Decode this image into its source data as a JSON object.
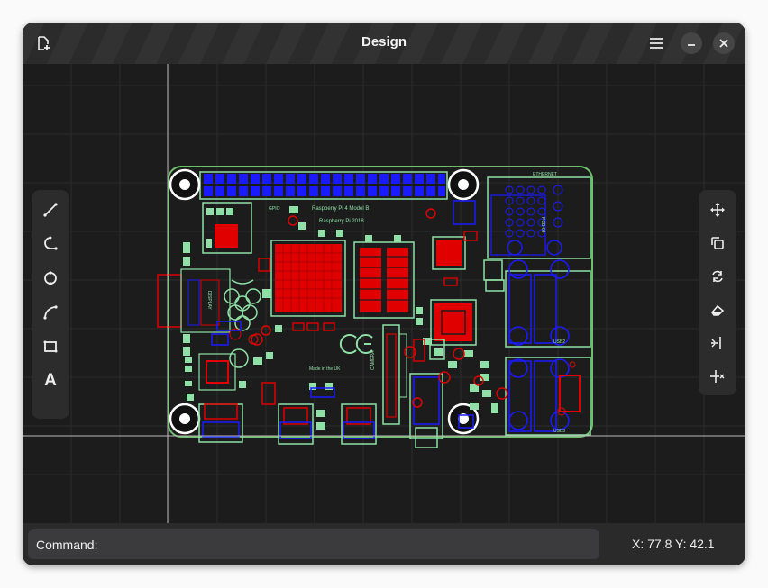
{
  "window": {
    "title": "Design"
  },
  "headerbar": {
    "new_icon": "new-document-icon",
    "menu_icon": "hamburger-menu-icon",
    "minimize_icon": "minimize-icon",
    "close_icon": "close-icon"
  },
  "left_toolbar": {
    "tools": [
      {
        "name": "line",
        "icon": "line-tool-icon"
      },
      {
        "name": "polyline",
        "icon": "polyline-tool-icon"
      },
      {
        "name": "circle",
        "icon": "circle-tool-icon"
      },
      {
        "name": "arc",
        "icon": "arc-tool-icon"
      },
      {
        "name": "rectangle",
        "icon": "rectangle-tool-icon"
      },
      {
        "name": "text",
        "icon": "text-tool-icon",
        "glyph": "A"
      }
    ]
  },
  "right_toolbar": {
    "tools": [
      {
        "name": "move",
        "icon": "move-icon"
      },
      {
        "name": "copy",
        "icon": "copy-icon"
      },
      {
        "name": "rotate",
        "icon": "rotate-icon"
      },
      {
        "name": "erase",
        "icon": "eraser-icon"
      },
      {
        "name": "trim",
        "icon": "trim-icon"
      },
      {
        "name": "extend",
        "icon": "extend-icon"
      }
    ]
  },
  "pcb": {
    "board_text": {
      "model": "Raspberry Pi 4 Model B",
      "year": "Raspberry Pi 2018",
      "made_in": "Made in the UK",
      "gpio": "GPIO",
      "display": "DISPLAY",
      "camera": "CAMERA",
      "ethernet": "ETHERNET",
      "usb2": "USB2",
      "usb3": "USB3",
      "pcb_rev": "PCB-84",
      "ce": "CE"
    },
    "colors": {
      "board_outline": "#6fbf6f",
      "silkscreen": "#8fe0a6",
      "top_copper": "#e00000",
      "bottom_copper": "#1a1aff",
      "grid": "#2c2c2c",
      "crosshair": "#b8b8b8",
      "pad_white": "#ffffff"
    }
  },
  "command": {
    "label": "Command:",
    "value": ""
  },
  "status": {
    "coordinates": "X: 77.8 Y: 42.1"
  }
}
